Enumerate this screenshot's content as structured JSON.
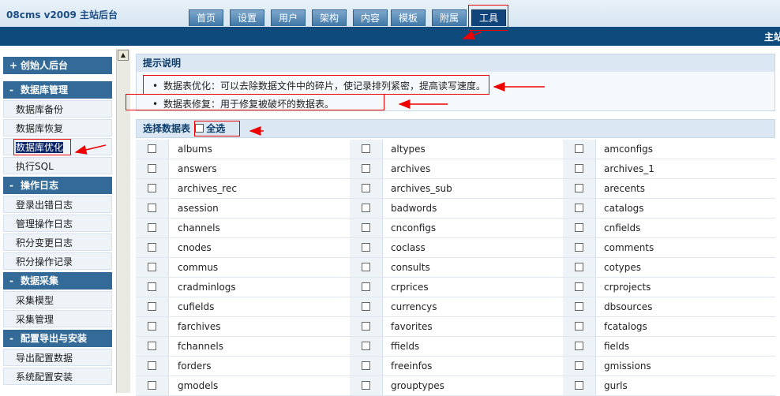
{
  "brand": "08cms  v2009 主站后台",
  "nav_tabs": [
    "首页",
    "设置",
    "用户",
    "架构",
    "内容",
    "模板",
    "附属",
    "工具"
  ],
  "active_tab_index": 7,
  "subbar_text": "主站",
  "sidebar": {
    "sections": [
      {
        "title": "创始人后台",
        "sign": "+",
        "items": []
      },
      {
        "title": "数据库管理",
        "sign": "-",
        "items": [
          "数据库备份",
          "数据库恢复",
          "数据库优化",
          "执行SQL"
        ]
      },
      {
        "title": "操作日志",
        "sign": "-",
        "items": [
          "登录出错日志",
          "管理操作日志",
          "积分变更日志",
          "积分操作记录"
        ]
      },
      {
        "title": "数据采集",
        "sign": "-",
        "items": [
          "采集模型",
          "采集管理"
        ]
      },
      {
        "title": "配置导出与安装",
        "sign": "-",
        "items": [
          "导出配置数据",
          "系统配置安装"
        ]
      }
    ],
    "selected_item": "数据库优化"
  },
  "tips": {
    "title": "提示说明",
    "items": [
      "数据表优化：可以去除数据文件中的碎片，使记录排列紧密，提高读写速度。",
      "数据表修复：用于修复被破坏的数据表。"
    ],
    "bullet": "•"
  },
  "select_table": {
    "title": "选择数据表",
    "select_all_label": "全选",
    "tables": [
      "albums",
      "altypes",
      "amconfigs",
      "answers",
      "archives",
      "archives_1",
      "archives_rec",
      "archives_sub",
      "arecents",
      "asession",
      "badwords",
      "catalogs",
      "channels",
      "cnconfigs",
      "cnfields",
      "cnodes",
      "coclass",
      "comments",
      "commus",
      "consults",
      "cotypes",
      "cradminlogs",
      "crprices",
      "crprojects",
      "cufields",
      "currencys",
      "dbsources",
      "farchives",
      "favorites",
      "fcatalogs",
      "fchannels",
      "ffields",
      "fields",
      "forders",
      "freeinfos",
      "gmissions",
      "gmodels",
      "grouptypes",
      "gurls"
    ]
  },
  "colors": {
    "accent": "#0f4a7c",
    "section_header": "#346a98",
    "annotation": "#ee0000"
  },
  "icons": {
    "scroll_up": "up-triangle",
    "bullet": "dot"
  }
}
